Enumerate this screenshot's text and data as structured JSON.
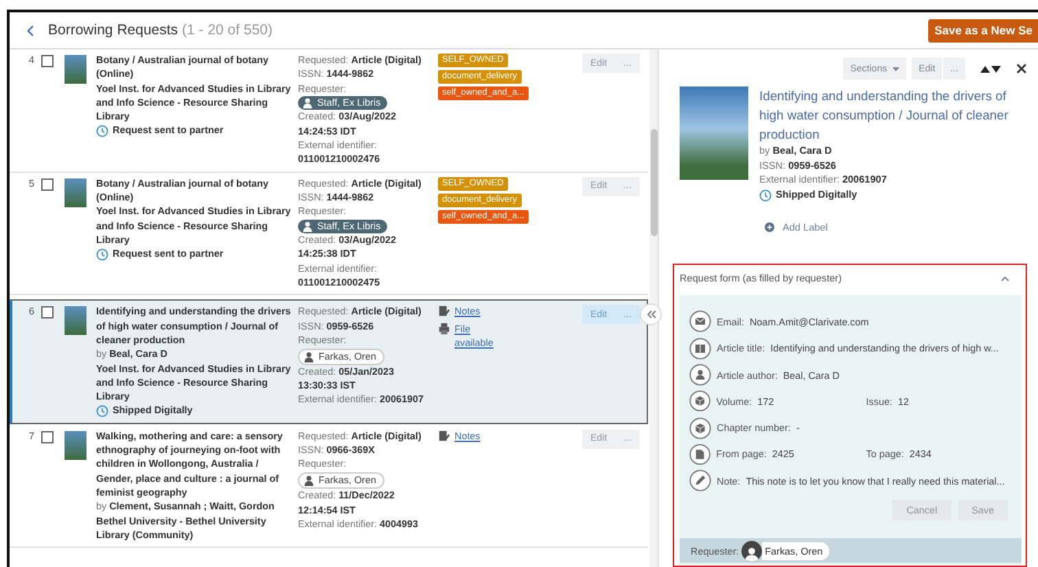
{
  "header": {
    "title": "Borrowing Requests",
    "count": "(1 - 20 of 550)",
    "save_button": "Save as a New Se"
  },
  "rows": [
    {
      "number": "4",
      "checked": false,
      "selected": false,
      "title": "Botany / Australian journal of botany (Online)",
      "library": "Yoel Inst. for Advanced Studies in Library and Info Science - Resource Sharing Library",
      "status": "Request sent to partner",
      "requested_label": "Requested:",
      "requested": "Article (Digital)",
      "issn_label": "ISSN:",
      "issn": "1444-9862",
      "requester_label": "Requester:",
      "requester": {
        "name": "Staff, Ex Libris",
        "kind": "staff"
      },
      "created_label": "Created:",
      "created": "03/Aug/2022 14:24:53 IDT",
      "external_label": "External identifier:",
      "external_identifier": "011001210002476",
      "tags": [
        {
          "label": "SELF_OWNED",
          "color": "#d4920b"
        },
        {
          "label": "document_delivery",
          "color": "#d4920b"
        },
        {
          "label": "self_owned_and_a...",
          "color": "#e8560f"
        }
      ],
      "links": [],
      "edit": "Edit",
      "more": "..."
    },
    {
      "number": "5",
      "checked": false,
      "selected": false,
      "title": "Botany / Australian journal of botany (Online)",
      "library": "Yoel Inst. for Advanced Studies in Library and Info Science - Resource Sharing Library",
      "status": "Request sent to partner",
      "requested_label": "Requested:",
      "requested": "Article (Digital)",
      "issn_label": "ISSN:",
      "issn": "1444-9862",
      "requester_label": "Requester:",
      "requester": {
        "name": "Staff, Ex Libris",
        "kind": "staff"
      },
      "created_label": "Created:",
      "created": "03/Aug/2022 14:25:38 IDT",
      "external_label": "External identifier:",
      "external_identifier": "011001210002475",
      "tags": [
        {
          "label": "SELF_OWNED",
          "color": "#d4920b"
        },
        {
          "label": "document_delivery",
          "color": "#d4920b"
        },
        {
          "label": "self_owned_and_a...",
          "color": "#e8560f"
        }
      ],
      "links": [],
      "edit": "Edit",
      "more": "..."
    },
    {
      "number": "6",
      "checked": false,
      "selected": true,
      "title": "Identifying and understanding the drivers of high water consumption / Journal of cleaner production",
      "by_label": "by",
      "by": "Beal, Cara D",
      "library": "Yoel Inst. for Advanced Studies in Library and Info Science - Resource Sharing Library",
      "status": "Shipped Digitally",
      "requested_label": "Requested:",
      "requested": "Article (Digital)",
      "issn_label": "ISSN:",
      "issn": "0959-6526",
      "requester_label": "Requester:",
      "requester": {
        "name": "Farkas, Oren",
        "kind": "patron"
      },
      "created_label": "Created:",
      "created": "05/Jan/2023 13:30:33 IST",
      "external_label": "External identifier:",
      "external_identifier": "20061907",
      "tags": [],
      "links": [
        {
          "label": "Notes",
          "kind": "notes"
        },
        {
          "label": "File available",
          "kind": "file"
        }
      ],
      "edit": "Edit",
      "more": "..."
    },
    {
      "number": "7",
      "checked": false,
      "selected": false,
      "title": "Walking, mothering and care: a sensory ethnography of journeying on-foot with children in Wollongong, Australia / Gender, place and culture : a journal of feminist geography",
      "by_label": "by",
      "by": "Clement, Susannah ; Waitt, Gordon",
      "library": "Bethel University - Bethel University Library (Community)",
      "requested_label": "Requested:",
      "requested": "Article (Digital)",
      "issn_label": "ISSN:",
      "issn": "0966-369X",
      "requester_label": "Requester:",
      "requester": {
        "name": "Farkas, Oren",
        "kind": "patron"
      },
      "created_label": "Created:",
      "created": "11/Dec/2022 12:14:54 IST",
      "external_label": "External identifier:",
      "external_identifier": "4004993",
      "tags": [],
      "links": [
        {
          "label": "Notes",
          "kind": "notes"
        }
      ],
      "edit": "Edit",
      "more": "..."
    }
  ],
  "detail": {
    "toolbar": {
      "sections": "Sections",
      "edit": "Edit",
      "more": "..."
    },
    "title": "Identifying and understanding the drivers of high water consumption / Journal of cleaner production",
    "by_label": "by",
    "by": "Beal, Cara D",
    "issn_label": "ISSN:",
    "issn": "0959-6526",
    "external_label": "External identifier:",
    "external_identifier": "20061907",
    "status": "Shipped Digitally",
    "add_label": "Add Label"
  },
  "request_form": {
    "title": "Request form (as filled by requester)",
    "expanded": true,
    "fields": [
      {
        "kind": "email",
        "items": [
          {
            "label": "Email:",
            "value": "Noam.Amit@Clarivate.com"
          }
        ]
      },
      {
        "kind": "book",
        "items": [
          {
            "label": "Article title:",
            "value": "Identifying and understanding the drivers of high w..."
          }
        ]
      },
      {
        "kind": "person",
        "items": [
          {
            "label": "Article author:",
            "value": "Beal, Cara D"
          }
        ]
      },
      {
        "kind": "cube",
        "items": [
          {
            "label": "Volume:",
            "value": "172"
          },
          {
            "label": "Issue:",
            "value": "12"
          }
        ]
      },
      {
        "kind": "cube",
        "items": [
          {
            "label": "Chapter number:",
            "value": "-"
          }
        ]
      },
      {
        "kind": "page",
        "items": [
          {
            "label": "From page:",
            "value": "2425"
          },
          {
            "label": "To page:",
            "value": "2434"
          }
        ]
      },
      {
        "kind": "pencil",
        "items": [
          {
            "label": "Note:",
            "value": "This note is to let you know that I really need this material..."
          }
        ]
      }
    ],
    "buttons": [
      {
        "label": "Cancel",
        "disabled": true
      },
      {
        "label": "Save",
        "disabled": true
      }
    ],
    "requester_label": "Requester:",
    "requester": "Farkas, Oren"
  }
}
